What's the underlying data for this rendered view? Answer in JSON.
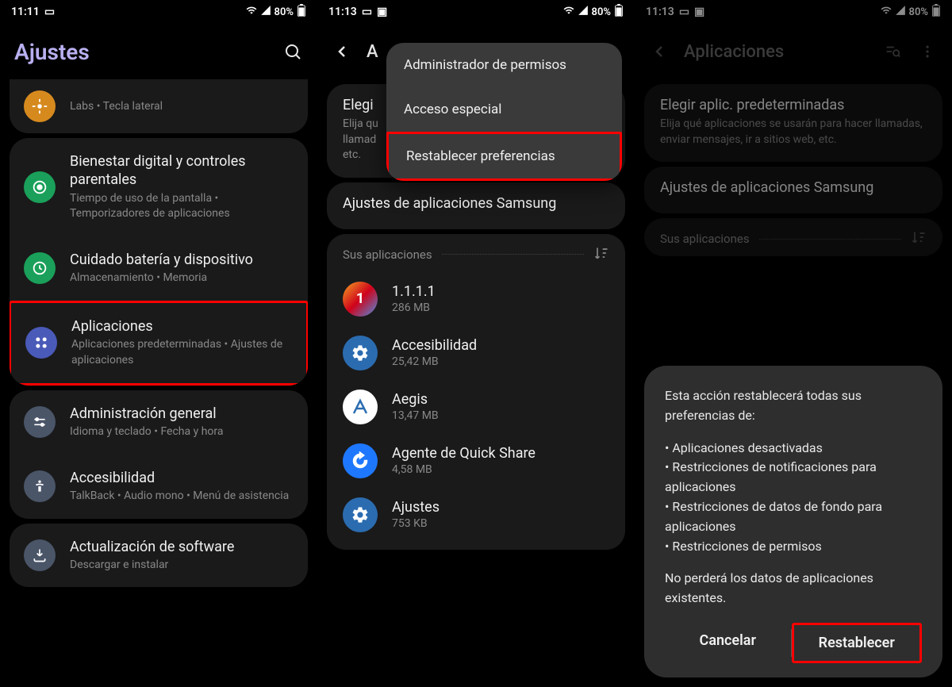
{
  "screen1": {
    "status": {
      "time": "11:11",
      "battery": "80%"
    },
    "header": {
      "title": "Ajustes"
    },
    "partial_item": {
      "sub": "Labs  •  Tecla lateral"
    },
    "items": [
      {
        "title": "Bienestar digital y controles parentales",
        "sub": "Tiempo de uso de la pantalla  •  Temporizadores de aplicaciones",
        "icon_bg": "#1aa05a"
      },
      {
        "title": "Cuidado batería y dispositivo",
        "sub": "Almacenamiento  •  Memoria",
        "icon_bg": "#1aa05a"
      },
      {
        "title": "Aplicaciones",
        "sub": "Aplicaciones predeterminadas  •  Ajustes de aplicaciones",
        "icon_bg": "#4a5ab8"
      },
      {
        "title": "Administración general",
        "sub": "Idioma y teclado  •  Fecha y hora",
        "icon_bg": "#4a5568"
      },
      {
        "title": "Accesibilidad",
        "sub": "TalkBack  •  Audio mono  •  Menú de asistencia",
        "icon_bg": "#4a5568"
      },
      {
        "title": "Actualización de software",
        "sub": "Descargar e instalar",
        "icon_bg": "#4a5568"
      }
    ]
  },
  "screen2": {
    "status": {
      "time": "11:13",
      "battery": "80%"
    },
    "header": {
      "title": "A"
    },
    "popup": {
      "items": [
        "Administrador de permisos",
        "Acceso especial",
        "Restablecer preferencias"
      ]
    },
    "default_apps": {
      "title": "Elegi",
      "sub": "Elija qu\nllamad\netc."
    },
    "samsung_settings": "Ajustes de aplicaciones Samsung",
    "section_label": "Sus aplicaciones",
    "apps": [
      {
        "name": "1.1.1.1",
        "size": "286 MB",
        "icon_bg": "linear-gradient(135deg,#f5a623,#d0021b,#4a90e2)",
        "glyph": "1"
      },
      {
        "name": "Accesibilidad",
        "size": "25,42 MB",
        "icon_bg": "#2b6cb0",
        "glyph": "⚙"
      },
      {
        "name": "Aegis",
        "size": "13,47 MB",
        "icon_bg": "#fff",
        "glyph": "▲",
        "glyph_color": "#2b6cb0"
      },
      {
        "name": "Agente de Quick Share",
        "size": "4,58 MB",
        "icon_bg": "#1e78ff",
        "glyph": "↻"
      },
      {
        "name": "Ajustes",
        "size": "753 KB",
        "icon_bg": "#2b6cb0",
        "glyph": "⚙"
      }
    ]
  },
  "screen3": {
    "status": {
      "time": "11:13",
      "battery": "80%"
    },
    "header": {
      "title": "Aplicaciones"
    },
    "default_apps": {
      "title": "Elegir aplic. predeterminadas",
      "sub": "Elija qué aplicaciones se usarán para hacer llamadas, enviar mensajes, ir a sitios web, etc."
    },
    "samsung_settings": "Ajustes de aplicaciones Samsung",
    "section_label": "Sus aplicaciones",
    "dialog": {
      "intro": "Esta acción restablecerá todas sus preferencias de:",
      "bullets": [
        "• Aplicaciones desactivadas",
        "• Restricciones de notificaciones para aplicaciones",
        "• Restricciones de datos de fondo para aplicaciones",
        "• Restricciones de permisos"
      ],
      "outro": "No perderá los datos de aplicaciones existentes.",
      "cancel": "Cancelar",
      "confirm": "Restablecer"
    }
  }
}
